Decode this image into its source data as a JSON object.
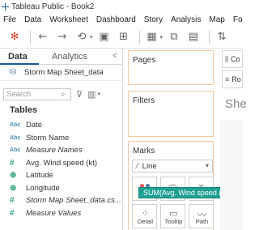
{
  "window": {
    "title": "Tableau Public - Book2"
  },
  "menu": [
    "File",
    "Data",
    "Worksheet",
    "Dashboard",
    "Story",
    "Analysis",
    "Map",
    "Format"
  ],
  "toolbar": {
    "icons": [
      "tableau-logo-icon",
      "undo-icon",
      "redo-icon",
      "new-sheet-icon",
      "duplicate-icon",
      "swap-icon",
      "highlight-icon"
    ]
  },
  "data_pane": {
    "tab_data": "Data",
    "tab_analytics": "Analytics",
    "collapse": "<",
    "datasource": "Storm Map Sheet_data",
    "search_placeholder": "Search",
    "tables_heading": "Tables",
    "fields": [
      {
        "type": "Abc",
        "name": "Date",
        "italic": false
      },
      {
        "type": "Abc",
        "name": "Storm Name",
        "italic": false
      },
      {
        "type": "Abc",
        "name": "Measure Names",
        "italic": true
      },
      {
        "type": "#",
        "name": "Avg. Wind speed (kt)",
        "italic": false
      },
      {
        "type": "⊕",
        "name": "Latitude",
        "italic": false
      },
      {
        "type": "⊕",
        "name": "Longitude",
        "italic": false
      },
      {
        "type": "#",
        "name": "Storm Map Sheet_data.cs...",
        "italic": true
      },
      {
        "type": "#",
        "name": "Measure Values",
        "italic": true
      }
    ]
  },
  "shelves": {
    "pages": "Pages",
    "filters": "Filters",
    "marks": "Marks",
    "mark_type": "Line",
    "mark_buttons": {
      "detail": "Detail",
      "tooltip": "Tooltip",
      "path": "Path"
    }
  },
  "drag_pill": "SUM(Avg. Wind speed (k...",
  "right": {
    "columns_label": "Co",
    "rows_label": "Ro",
    "sheet_title": "She"
  }
}
